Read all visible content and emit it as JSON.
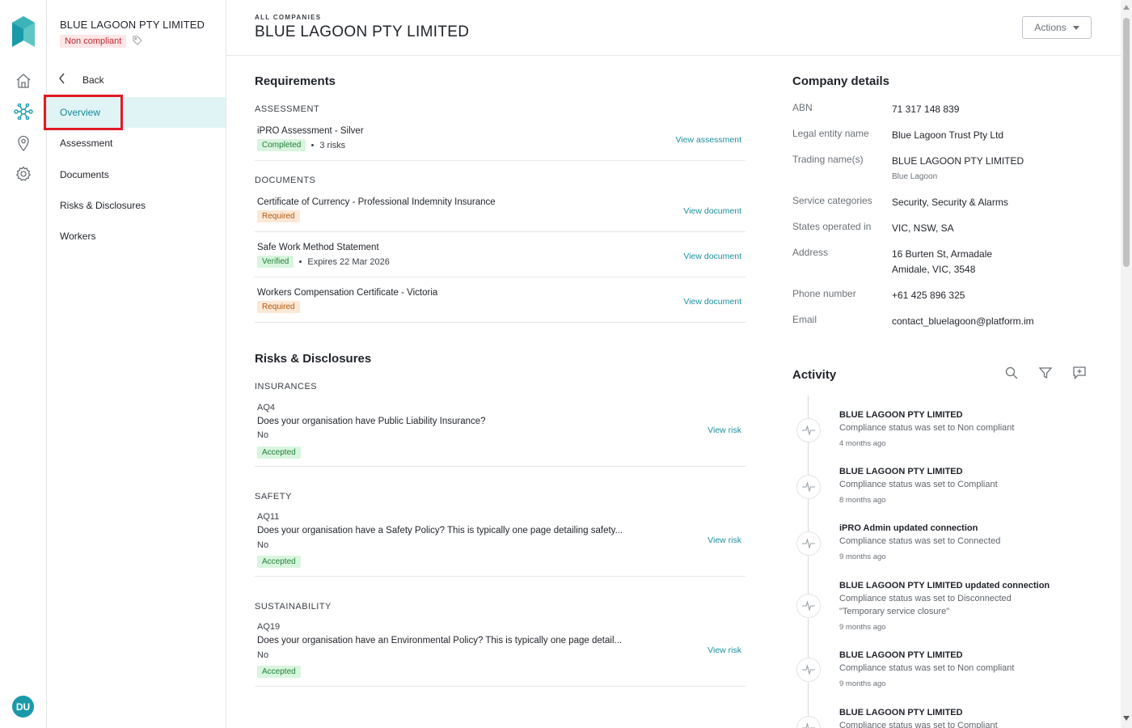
{
  "company": {
    "name": "BLUE LAGOON PTY LIMITED",
    "status_badge": "Non compliant"
  },
  "rail": {
    "avatar_initials": "DU",
    "icons": [
      "logo-icon",
      "home-icon",
      "network-icon",
      "location-pin-icon",
      "settings-gear-icon"
    ]
  },
  "sidebar": {
    "back_label": "Back",
    "items": [
      {
        "label": "Overview",
        "active": true
      },
      {
        "label": "Assessment"
      },
      {
        "label": "Documents"
      },
      {
        "label": "Risks & Disclosures"
      },
      {
        "label": "Workers"
      }
    ]
  },
  "header": {
    "breadcrumb": "ALL COMPANIES",
    "title": "BLUE LAGOON PTY LIMITED",
    "actions_label": "Actions"
  },
  "requirements": {
    "title": "Requirements",
    "assessment_label": "ASSESSMENT",
    "assessment": {
      "name": "iPRO Assessment - Silver",
      "status": "Completed",
      "risks": "3 risks",
      "link": "View assessment"
    },
    "documents_label": "DOCUMENTS",
    "documents": [
      {
        "name": "Certificate of Currency - Professional Indemnity Insurance",
        "status": "Required",
        "link": "View document"
      },
      {
        "name": "Safe Work Method Statement",
        "status": "Verified",
        "expiry_prefix": "Expires",
        "expiry_date": "22 Mar 2026",
        "link": "View document"
      },
      {
        "name": "Workers Compensation Certificate - Victoria",
        "status": "Required",
        "link": "View document"
      }
    ]
  },
  "risks": {
    "title": "Risks & Disclosures",
    "groups": [
      {
        "label": "INSURANCES",
        "code": "AQ4",
        "question": "Does your organisation have Public Liability Insurance?",
        "answer": "No",
        "status": "Accepted",
        "link": "View risk"
      },
      {
        "label": "SAFETY",
        "code": "AQ11",
        "question": "Does your organisation have a Safety Policy? This is typically one page detailing safety...",
        "answer": "No",
        "status": "Accepted",
        "link": "View risk"
      },
      {
        "label": "SUSTAINABILITY",
        "code": "AQ19",
        "question": "Does your organisation have an Environmental Policy? This is typically one page detail...",
        "answer": "No",
        "status": "Accepted",
        "link": "View risk"
      }
    ]
  },
  "details": {
    "title": "Company details",
    "abn_label": "ABN",
    "abn": "71 317 148 839",
    "legal_label": "Legal entity name",
    "legal": "Blue Lagoon Trust Pty Ltd",
    "trading_label": "Trading name(s)",
    "trading": "BLUE LAGOON PTY LIMITED",
    "trading_alt": "Blue Lagoon",
    "service_label": "Service categories",
    "service": "Security, Security & Alarms",
    "states_label": "States operated in",
    "states": "VIC, NSW, SA",
    "address_label": "Address",
    "address_line1": "16 Burten St, Armadale",
    "address_line2": "Amidale, VIC, 3548",
    "phone_label": "Phone number",
    "phone": "+61 425 896 325",
    "email_label": "Email",
    "email": "contact_bluelagoon@platform.im"
  },
  "activity": {
    "title": "Activity",
    "items": [
      {
        "who": "BLUE LAGOON PTY LIMITED",
        "what": "Compliance status was set to Non compliant",
        "when": "4 months ago"
      },
      {
        "who": "BLUE LAGOON PTY LIMITED",
        "what": "Compliance status was set to Compliant",
        "when": "8 months ago"
      },
      {
        "who": "iPRO Admin updated connection",
        "what": "Compliance status was set to Connected",
        "when": "9 months ago"
      },
      {
        "who": "BLUE LAGOON PTY LIMITED updated connection",
        "what": "Compliance status was set to Disconnected",
        "note": "\"Temporary service closure\"",
        "when": "9 months ago"
      },
      {
        "who": "BLUE LAGOON PTY LIMITED",
        "what": "Compliance status was set to Non compliant",
        "when": "9 months ago"
      },
      {
        "who": "BLUE LAGOON PTY LIMITED",
        "what": "Compliance status was set to Compliant"
      }
    ]
  },
  "colors": {
    "accent": "#1a9aa8",
    "active_bg": "#e0f4f5",
    "success_bg": "#d9f5de",
    "warning_bg": "#fde8d6",
    "danger_bg": "#fde6e7",
    "highlight": "#e01b24"
  }
}
